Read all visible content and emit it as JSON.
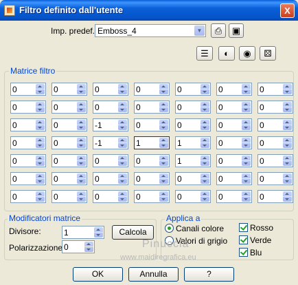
{
  "window": {
    "title": "Filtro definito dall'utente",
    "close": "X"
  },
  "preset": {
    "label": "Imp. predef.:",
    "value": "Emboss_4"
  },
  "toolbar_icons": [
    "save-icon",
    "disk-icon",
    "list-icon",
    "eye-dropper-icon",
    "eye-icon",
    "dice-icon"
  ],
  "matrix": {
    "title": "Matrice filtro",
    "rows": [
      [
        "0",
        "0",
        "0",
        "0",
        "0",
        "0",
        "0"
      ],
      [
        "0",
        "0",
        "0",
        "0",
        "0",
        "0",
        "0"
      ],
      [
        "0",
        "0",
        "-1",
        "0",
        "0",
        "0",
        "0"
      ],
      [
        "0",
        "0",
        "-1",
        "1",
        "1",
        "0",
        "0"
      ],
      [
        "0",
        "0",
        "0",
        "0",
        "1",
        "0",
        "0"
      ],
      [
        "0",
        "0",
        "0",
        "0",
        "0",
        "0",
        "0"
      ],
      [
        "0",
        "0",
        "0",
        "0",
        "0",
        "0",
        "0"
      ]
    ]
  },
  "modifiers": {
    "title": "Modificatori matrice",
    "divisor_label": "Divisore:",
    "divisor_value": "1",
    "bias_label": "Polarizzazione:",
    "bias_value": "0",
    "compute_label": "Calcola"
  },
  "apply": {
    "title": "Applica a",
    "radio_color": "Canali colore",
    "radio_gray": "Valori di grigio",
    "check_red": "Rosso",
    "check_green": "Verde",
    "check_blue": "Blu"
  },
  "buttons": {
    "ok": "OK",
    "cancel": "Annulla",
    "help": "?"
  },
  "watermark": {
    "name": "Pinuccia",
    "url": "www.maidiregrafica.eu"
  }
}
